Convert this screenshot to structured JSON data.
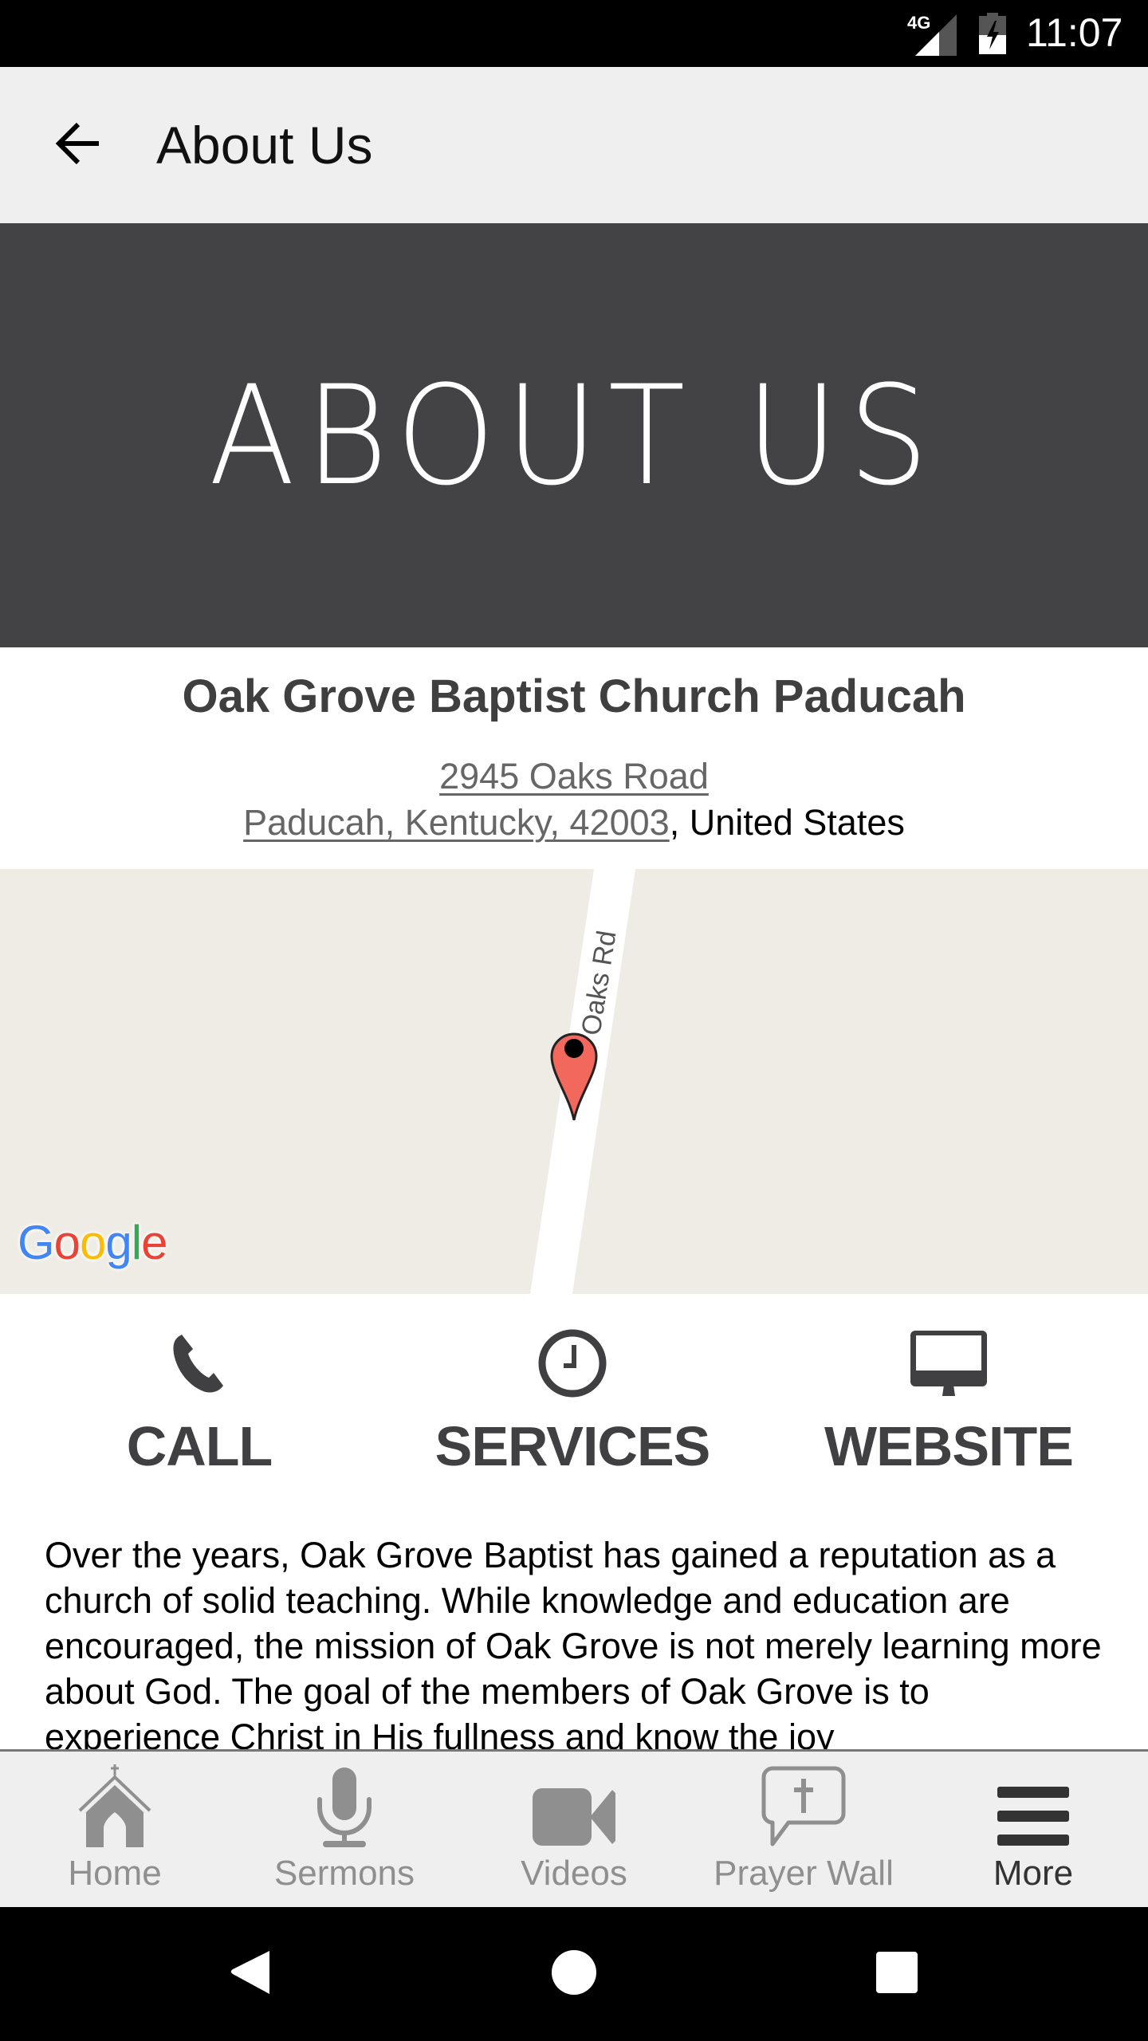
{
  "status_bar": {
    "network": "4G",
    "time": "11:07"
  },
  "app_bar": {
    "title": "About Us",
    "back_icon": "arrow-left-icon"
  },
  "hero": {
    "text": "ABOUT US"
  },
  "church": {
    "name": "Oak Grove Baptist Church Paducah",
    "address_line1": "2945 Oaks Road",
    "address_line2_link": "Paducah, Kentucky, 42003",
    "address_line2_suffix": ", United States"
  },
  "map": {
    "road_label": "Oaks Rd",
    "provider": "Google",
    "marker_icon": "map-pin-icon",
    "colors": {
      "land": "#efece5",
      "road": "#ffffff",
      "pin": "#f2685c"
    }
  },
  "actions": [
    {
      "label": "CALL",
      "icon": "phone-icon"
    },
    {
      "label": "SERVICES",
      "icon": "clock-icon"
    },
    {
      "label": "WEBSITE",
      "icon": "monitor-icon"
    }
  ],
  "description": "Over the years, Oak Grove Baptist has gained a reputation as a church of solid teaching. While knowledge and education are encouraged, the mission of Oak Grove is not merely learning more about God. The goal of the members of Oak Grove is to experience Christ in His fullness and know the joy",
  "tabs": [
    {
      "label": "Home",
      "icon": "church-icon",
      "active": false
    },
    {
      "label": "Sermons",
      "icon": "microphone-icon",
      "active": false
    },
    {
      "label": "Videos",
      "icon": "video-camera-icon",
      "active": false
    },
    {
      "label": "Prayer Wall",
      "icon": "prayer-bubble-icon",
      "active": false
    },
    {
      "label": "More",
      "icon": "menu-icon",
      "active": true
    }
  ],
  "nav": {
    "back": "nav-back-icon",
    "home": "nav-home-icon",
    "recents": "nav-recents-icon"
  },
  "colors": {
    "accent_dark": "#404042",
    "inactive": "#8f8f8f",
    "hero_bg": "#434345",
    "app_bar_bg": "#efefef"
  }
}
